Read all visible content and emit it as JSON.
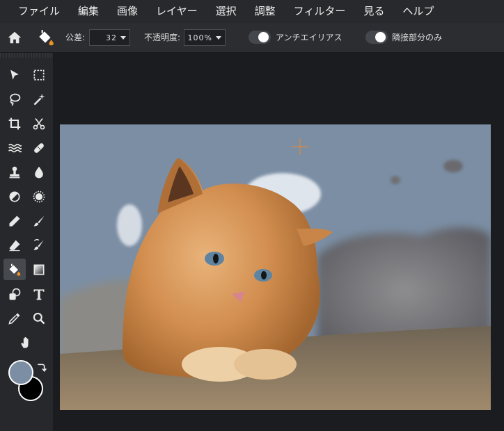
{
  "menu": [
    "ファイル",
    "編集",
    "画像",
    "レイヤー",
    "選択",
    "調整",
    "フィルター",
    "見る",
    "ヘルプ"
  ],
  "options": {
    "tolerance_label": "公差:",
    "tolerance_value": "32",
    "opacity_label": "不透明度:",
    "opacity_value": "100%",
    "antialias_label": "アンチエイリアス",
    "antialias_on": true,
    "contiguous_label": "隣接部分のみ",
    "contiguous_on": true
  },
  "tools": [
    "move-tool",
    "marquee-tool",
    "lasso-tool",
    "magic-wand-tool",
    "crop-tool",
    "cut-tool",
    "liquify-tool",
    "healing-tool",
    "clone-stamp-tool",
    "blur-tool",
    "dodge-tool",
    "sponge-tool",
    "pencil-tool",
    "brush-tool",
    "eraser-tool",
    "color-replace-tool",
    "paint-bucket-tool",
    "gradient-tool",
    "shape-tool",
    "text-tool",
    "eyedropper-tool",
    "zoom-tool",
    "hand-tool"
  ],
  "active_tool": "paint-bucket-tool",
  "colors": {
    "foreground": "#7b8ea4",
    "background": "#000000"
  }
}
